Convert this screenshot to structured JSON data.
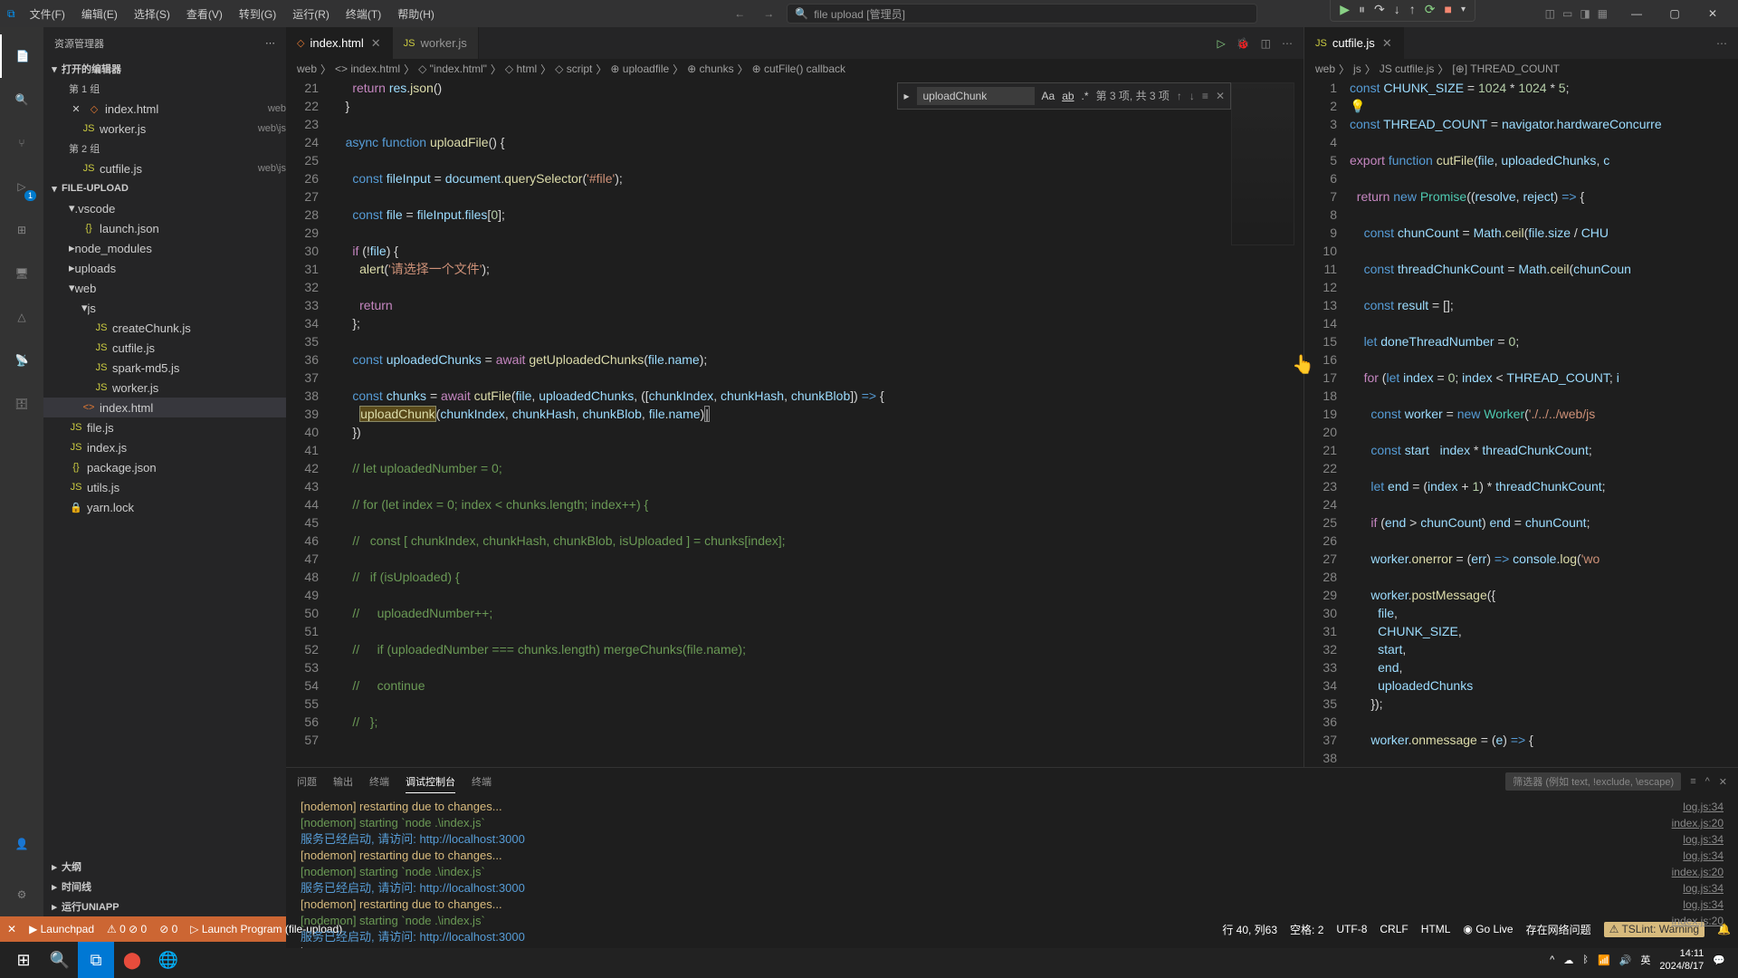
{
  "menubar": [
    "文件(F)",
    "编辑(E)",
    "选择(S)",
    "查看(V)",
    "转到(G)",
    "运行(R)",
    "终端(T)",
    "帮助(H)"
  ],
  "titleSearch": "file upload [管理员]",
  "sidebar": {
    "title": "资源管理器",
    "openEditors": "打开的编辑器",
    "group1": "第 1 组",
    "group2": "第 2 组",
    "editors": [
      {
        "name": "index.html",
        "dim": "web"
      },
      {
        "name": "worker.js",
        "dim": "web\\js"
      },
      {
        "name": "cutfile.js",
        "dim": "web\\js"
      }
    ],
    "project": "FILE-UPLOAD",
    "tree": [
      {
        "type": "folder",
        "name": ".vscode",
        "indent": 1,
        "open": true
      },
      {
        "type": "file",
        "name": "launch.json",
        "indent": 2,
        "icon": "{}"
      },
      {
        "type": "folder",
        "name": "node_modules",
        "indent": 1
      },
      {
        "type": "folder",
        "name": "uploads",
        "indent": 1
      },
      {
        "type": "folder",
        "name": "web",
        "indent": 1,
        "open": true
      },
      {
        "type": "folder",
        "name": "js",
        "indent": 2,
        "open": true
      },
      {
        "type": "file",
        "name": "createChunk.js",
        "indent": 3,
        "icon": "JS"
      },
      {
        "type": "file",
        "name": "cutfile.js",
        "indent": 3,
        "icon": "JS"
      },
      {
        "type": "file",
        "name": "spark-md5.js",
        "indent": 3,
        "icon": "JS"
      },
      {
        "type": "file",
        "name": "worker.js",
        "indent": 3,
        "icon": "JS"
      },
      {
        "type": "file",
        "name": "index.html",
        "indent": 2,
        "icon": "<>",
        "active": true
      },
      {
        "type": "file",
        "name": "file.js",
        "indent": 1,
        "icon": "JS"
      },
      {
        "type": "file",
        "name": "index.js",
        "indent": 1,
        "icon": "JS"
      },
      {
        "type": "file",
        "name": "package.json",
        "indent": 1,
        "icon": "{}"
      },
      {
        "type": "file",
        "name": "utils.js",
        "indent": 1,
        "icon": "JS"
      },
      {
        "type": "file",
        "name": "yarn.lock",
        "indent": 1,
        "icon": "🔒"
      }
    ],
    "outline": "大纲",
    "timeline": "时间线",
    "uniapp": "运行UNIAPP"
  },
  "tabs": {
    "left": [
      {
        "name": "index.html",
        "active": true
      },
      {
        "name": "worker.js"
      }
    ],
    "right": [
      {
        "name": "cutfile.js",
        "active": true
      }
    ]
  },
  "breadcrumbLeft": [
    "web",
    "〉",
    "<> index.html",
    "〉",
    "◇ \"index.html\"",
    "〉",
    "◇ html",
    "〉",
    "◇ script",
    "〉",
    "⊕ uploadfile",
    "〉",
    "⊕ chunks",
    "〉",
    "⊕ cutFile() callback"
  ],
  "breadcrumbRight": [
    "web",
    "〉",
    "js",
    "〉",
    "JS cutfile.js",
    "〉",
    "[⊕] THREAD_COUNT"
  ],
  "find": {
    "value": "uploadChunk",
    "count": "第 3 项, 共 3 项"
  },
  "codeLeft": {
    "start": 21,
    "lines": [
      "      <span class='kw2'>return</span> <span class='var'>res</span>.<span class='fn'>json</span>()",
      "    }",
      "",
      "    <span class='kw'>async function</span> <span class='fn'>uploadFile</span>() {",
      "",
      "      <span class='kw'>const</span> <span class='var'>fileInput</span> = <span class='var'>document</span>.<span class='fn'>querySelector</span>(<span class='str'>'#file'</span>);",
      "",
      "      <span class='kw'>const</span> <span class='var'>file</span> = <span class='var'>fileInput</span>.<span class='var'>files</span>[<span class='num'>0</span>];",
      "",
      "      <span class='kw2'>if</span> (!<span class='var'>file</span>) {",
      "        <span class='fn'>alert</span>(<span class='str'>'请选择一个文件'</span>);",
      "",
      "        <span class='kw2'>return</span>",
      "      };",
      "",
      "      <span class='kw'>const</span> <span class='var'>uploadedChunks</span> = <span class='kw2'>await</span> <span class='fn'>getUploadedChunks</span>(<span class='var'>file</span>.<span class='var'>name</span>);",
      "",
      "      <span class='kw'>const</span> <span class='var'>chunks</span> = <span class='kw2'>await</span> <span class='fn'>cutFile</span>(<span class='var'>file</span>, <span class='var'>uploadedChunks</span>, ([<span class='var'>chunkIndex</span>, <span class='var'>chunkHash</span>, <span class='var'>chunkBlob</span>]) <span class='kw'>=&gt;</span> {",
      "        <span style='background:#5a4a1a;border:1px solid #886;'><span class='fn'>uploadChunk</span></span>(<span class='var'>chunkIndex</span>, <span class='var'>chunkHash</span>, <span class='var'>chunkBlob</span>, <span class='var'>file</span>.<span class='var'>name</span>)<span style='border:1px solid #888'>|</span>",
      "      })",
      "",
      "      <span class='cmt'>// let uploadedNumber = 0;</span>",
      "",
      "      <span class='cmt'>// for (let index = 0; index &lt; chunks.length; index++) {</span>",
      "",
      "      <span class='cmt'>//   const [ chunkIndex, chunkHash, chunkBlob, isUploaded ] = chunks[index];</span>",
      "",
      "      <span class='cmt'>//   if (isUploaded) {</span>",
      "",
      "      <span class='cmt'>//     uploadedNumber++;</span>",
      "",
      "      <span class='cmt'>//     if (uploadedNumber === chunks.length) mergeChunks(file.name);</span>",
      "",
      "      <span class='cmt'>//     continue</span>",
      "",
      "      <span class='cmt'>//   };</span>",
      ""
    ]
  },
  "codeRight": {
    "start": 1,
    "lines": [
      "<span class='kw'>const</span> <span class='var'>CHUNK_SIZE</span> = <span class='num'>1024</span> * <span class='num'>1024</span> * <span class='num'>5</span>;",
      "<span style='color:#d7ba7d'>💡</span>",
      "<span class='kw'>const</span> <span class='var'>THREAD_COUNT</span> = <span class='var'>navigator</span>.<span class='var'>hardwareConcurre</span>",
      "",
      "<span class='kw2'>export</span> <span class='kw'>function</span> <span class='fn'>cutFile</span>(<span class='var'>file</span>, <span class='var'>uploadedChunks</span>, <span class='var'>c</span>",
      "",
      "  <span class='kw2'>return</span> <span class='kw'>new</span> <span class='typ'>Promise</span>((<span class='var'>resolve</span>, <span class='var'>reject</span>) <span class='kw'>=&gt;</span> {",
      "",
      "    <span class='kw'>const</span> <span class='var'>chunCount</span> = <span class='var'>Math</span>.<span class='fn'>ceil</span>(<span class='var'>file</span>.<span class='var'>size</span> / <span class='var'>CHU</span>",
      "",
      "    <span class='kw'>const</span> <span class='var'>threadChunkCount</span> = <span class='var'>Math</span>.<span class='fn'>ceil</span>(<span class='var'>chunCoun</span>",
      "",
      "    <span class='kw'>const</span> <span class='var'>result</span> = [];",
      "",
      "    <span class='kw'>let</span> <span class='var'>doneThreadNumber</span> = <span class='num'>0</span>;",
      "",
      "    <span class='kw2'>for</span> (<span class='kw'>let</span> <span class='var'>index</span> = <span class='num'>0</span>; <span class='var'>index</span> &lt; <span class='var'>THREAD_COUNT</span>; <span class='var'>i</span>",
      "",
      "      <span class='kw'>const</span> <span class='var'>worker</span> = <span class='kw'>new</span> <span class='typ'>Worker</span>(<span class='str'>'./../../web/js</span>",
      "",
      "      <span class='kw'>const</span> <span class='var'>start</span>   <span class='var'>index</span> * <span class='var'>threadChunkCount</span>;",
      "",
      "      <span class='kw'>let</span> <span class='var'>end</span> = (<span class='var'>index</span> + <span class='num'>1</span>) * <span class='var'>threadChunkCount</span>;",
      "",
      "      <span class='kw2'>if</span> (<span class='var'>end</span> &gt; <span class='var'>chunCount</span>) <span class='var'>end</span> = <span class='var'>chunCount</span>;",
      "",
      "      <span class='var'>worker</span>.<span class='fn'>onerror</span> = (<span class='var'>err</span>) <span class='kw'>=&gt;</span> <span class='var'>console</span>.<span class='fn'>log</span>(<span class='str'>'wo</span>",
      "",
      "      <span class='var'>worker</span>.<span class='fn'>postMessage</span>({",
      "        <span class='var'>file</span>,",
      "        <span class='var'>CHUNK_SIZE</span>,",
      "        <span class='var'>start</span>,",
      "        <span class='var'>end</span>,",
      "        <span class='var'>uploadedChunks</span>",
      "      });",
      "",
      "      <span class='var'>worker</span>.<span class='fn'>onmessage</span> = (<span class='var'>e</span>) <span class='kw'>=&gt;</span> {",
      ""
    ]
  },
  "panel": {
    "tabs": [
      "问题",
      "输出",
      "终端",
      "调试控制台",
      "终端"
    ],
    "activeTab": 3,
    "filter": "筛选器 (例如 text, !exclude, \\escape)",
    "lines": [
      {
        "cls": "ylw",
        "text": "[nodemon] restarting due to changes..."
      },
      {
        "cls": "grn",
        "text": "[nodemon] starting `node .\\index.js`"
      },
      {
        "cls": "blu",
        "text": "服务已经启动, 请访问: http://localhost:3000"
      },
      {
        "cls": "ylw",
        "text": "[nodemon] restarting due to changes..."
      },
      {
        "cls": "grn",
        "text": "[nodemon] starting `node .\\index.js`"
      },
      {
        "cls": "blu",
        "text": "服务已经启动, 请访问: http://localhost:3000"
      },
      {
        "cls": "ylw",
        "text": "[nodemon] restarting due to changes..."
      },
      {
        "cls": "grn",
        "text": "[nodemon] starting `node .\\index.js`"
      },
      {
        "cls": "blu",
        "text": "服务已经启动, 请访问: http://localhost:3000"
      }
    ],
    "rightLinks": [
      "log.js:34",
      "index.js:20",
      "log.js:34",
      "log.js:34",
      "index.js:20",
      "log.js:34",
      "log.js:34",
      "index.js:20"
    ]
  },
  "statusbar": {
    "left": [
      "✕",
      "▶ Launchpad",
      "⚠ 0 ⊘ 0",
      "⊘ 0",
      "▷ Launch Program (file-upload)"
    ],
    "right": [
      "行 40, 列63",
      "空格: 2",
      "UTF-8",
      "CRLF",
      "HTML",
      "◉ Go Live",
      "存在网络问题",
      "⚠ TSLint: Warning",
      "🔔"
    ]
  },
  "taskbar": {
    "time": "14:11",
    "date": "2024/8/17",
    "lang": "英"
  }
}
